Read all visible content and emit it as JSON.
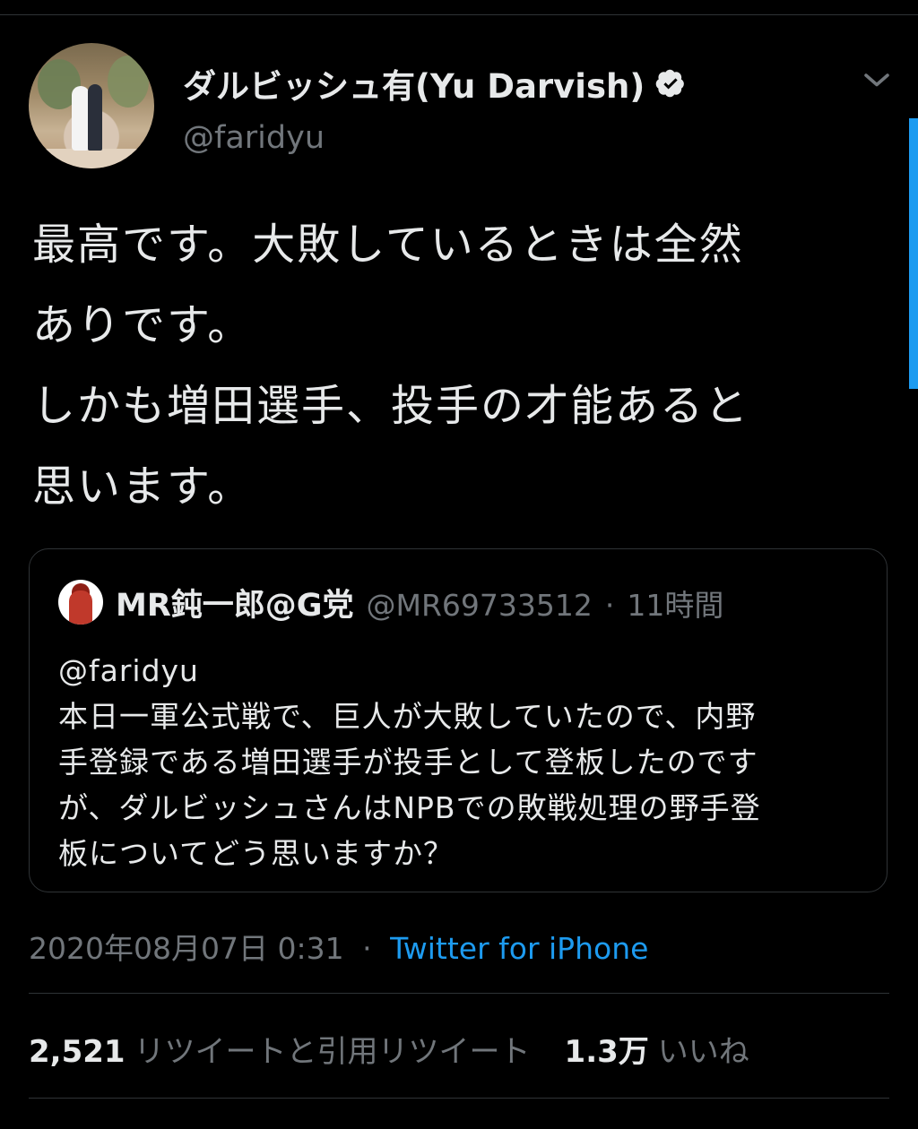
{
  "author": {
    "display_name": "ダルビッシュ有(Yu Darvish)",
    "handle": "@faridyu",
    "verified": true,
    "verified_icon": "verified-badge-icon"
  },
  "tweet": {
    "lines": [
      "最高です。大敗しているときは全然",
      "ありです。",
      "しかも増田選手、投手の才能あると",
      "思います。"
    ]
  },
  "quoted_tweet": {
    "display_name": "MR鈍一郎@G党",
    "handle": "@MR69733512",
    "separator": "·",
    "time_ago": "11時間",
    "lines": [
      "@faridyu",
      "本日一軍公式戦で、巨人が大敗していたので、内野",
      "手登録である増田選手が投手として登板したのです",
      "が、ダルビッシュさんはNPBでの敗戦処理の野手登",
      "板についてどう思いますか？"
    ]
  },
  "meta": {
    "timestamp": "2020年08月07日 0:31",
    "separator": "·",
    "source": "Twitter for iPhone"
  },
  "stats": {
    "retweets_count": "2,521",
    "retweets_label": "リツイートと引用リツイート",
    "likes_count": "1.3万",
    "likes_label": "いいね"
  },
  "colors": {
    "background": "#000000",
    "text_primary": "#e7e9ea",
    "text_secondary": "#71767b",
    "link_blue": "#1d9bf0",
    "divider": "#2f3336"
  }
}
